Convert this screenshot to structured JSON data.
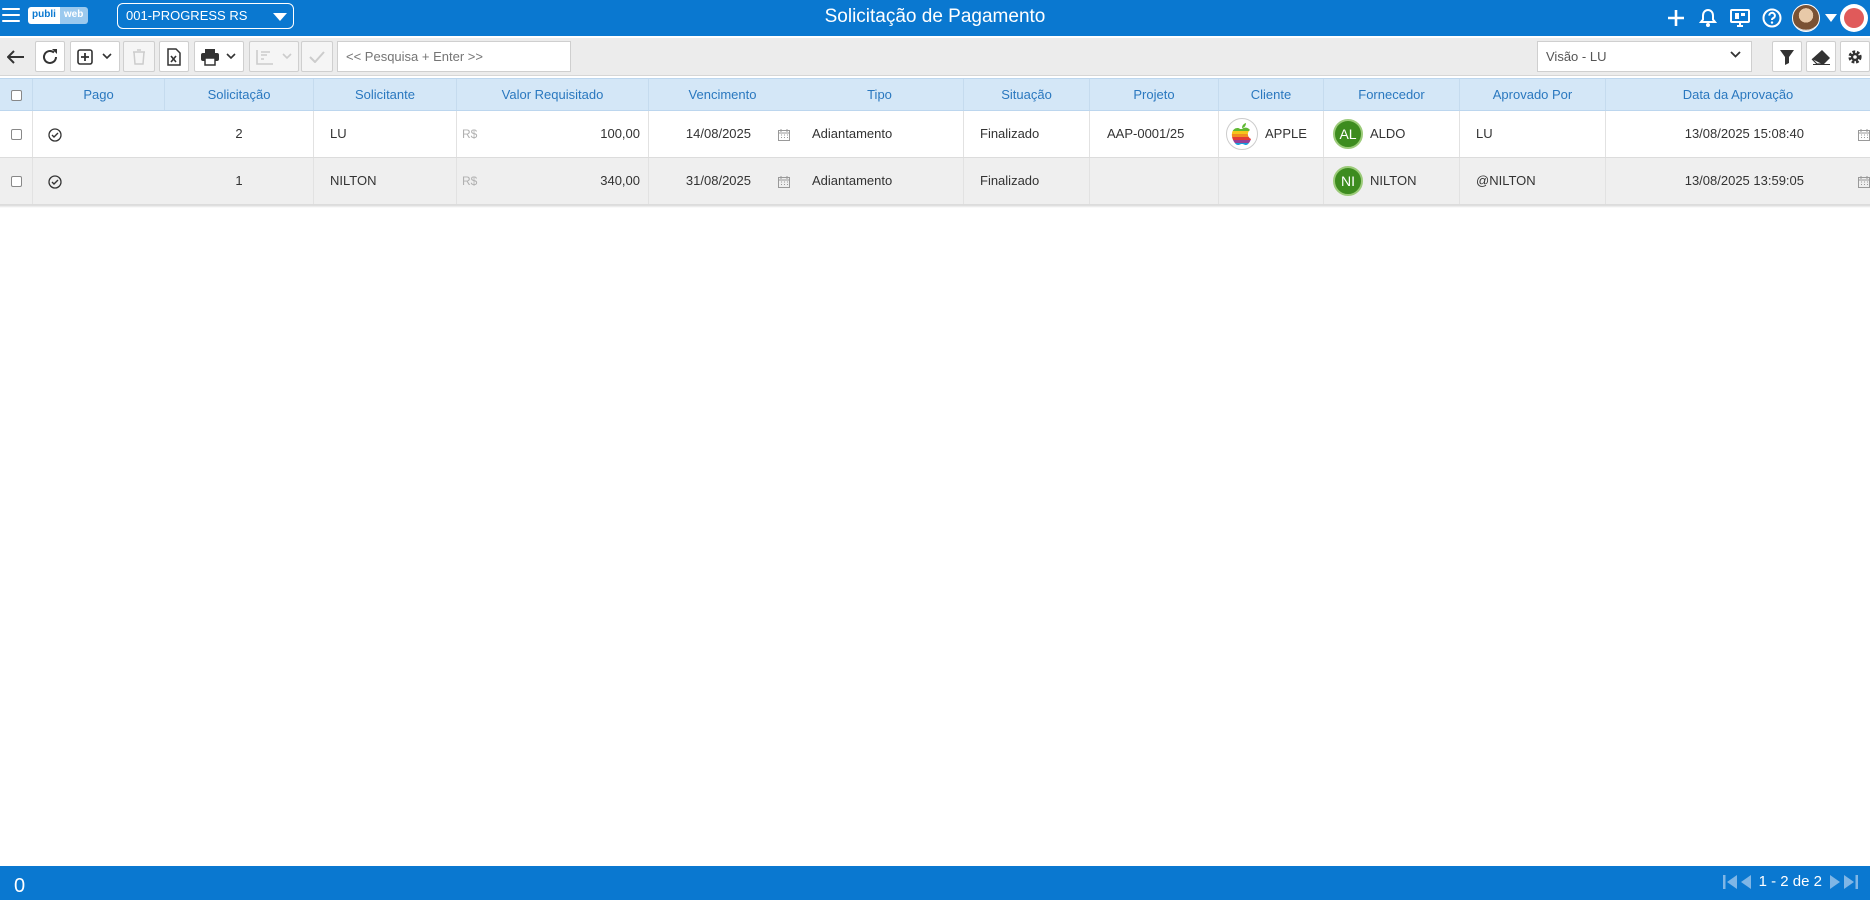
{
  "header": {
    "logo_left": "publi",
    "logo_right": "web",
    "company": "001-PROGRESS RS",
    "title": "Solicitação de Pagamento"
  },
  "toolbar": {
    "search_placeholder": "<< Pesquisa + Enter >>",
    "view": "Visão - LU"
  },
  "table": {
    "columns": [
      "Pago",
      "Solicitação",
      "Solicitante",
      "Valor Requisitado",
      "Vencimento",
      "Tipo",
      "Situação",
      "Projeto",
      "Cliente",
      "Fornecedor",
      "Aprovado Por",
      "Data da Aprovação"
    ],
    "rows": [
      {
        "solicitacao": "2",
        "solicitante": "LU",
        "currency": "R$",
        "valor": "100,00",
        "vencimento": "14/08/2025",
        "tipo": "Adiantamento",
        "situacao": "Finalizado",
        "projeto": "AAP-0001/25",
        "cliente": "APPLE",
        "cliente_logo": "apple-logo",
        "fornecedor_initials": "AL",
        "fornecedor": "ALDO",
        "aprovado_por": "LU",
        "data_aprovacao": "13/08/2025 15:08:40"
      },
      {
        "solicitacao": "1",
        "solicitante": "NILTON",
        "currency": "R$",
        "valor": "340,00",
        "vencimento": "31/08/2025",
        "tipo": "Adiantamento",
        "situacao": "Finalizado",
        "projeto": "",
        "cliente": "",
        "cliente_logo": "",
        "fornecedor_initials": "NI",
        "fornecedor": "NILTON",
        "aprovado_por": "@NILTON",
        "data_aprovacao": "13/08/2025 13:59:05"
      }
    ]
  },
  "footer": {
    "count": "0",
    "pagination": "1 - 2 de 2"
  },
  "colors": {
    "brand": "#0a78d0",
    "header_row": "#d4e7f7",
    "column_header_text": "#2a78bf",
    "supplier_badge": "#3d8c1f"
  }
}
